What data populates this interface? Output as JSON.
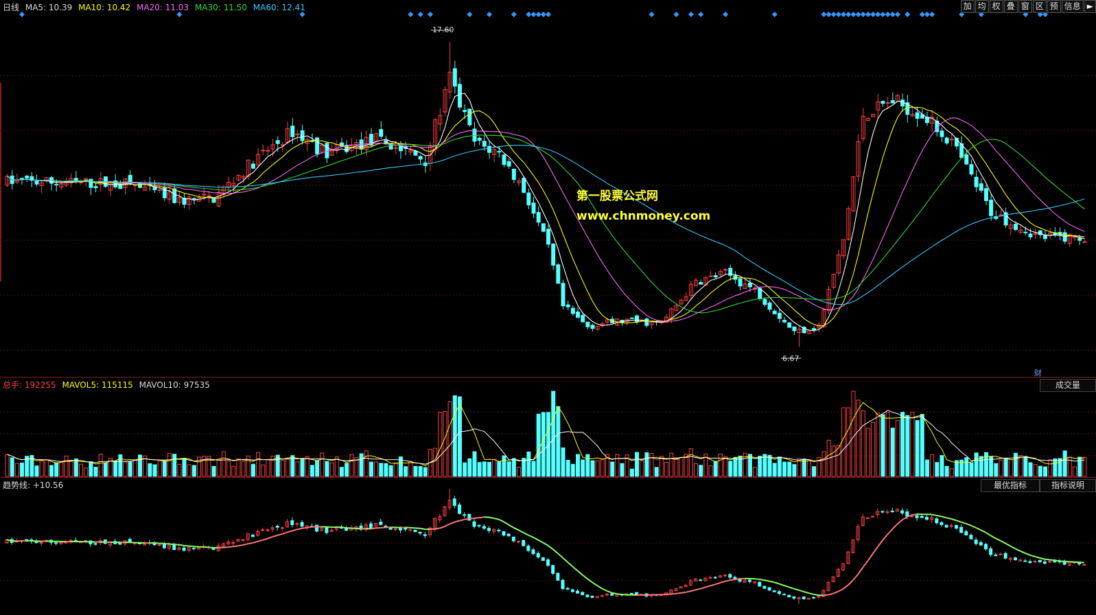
{
  "colors": {
    "up": "#ff4040",
    "down": "#54ffff",
    "ma5": "#ffffff",
    "ma10": "#ffff00",
    "ma20": "#ff66ff",
    "ma30": "#33dd33",
    "ma60": "#33ccff",
    "diamond": "#3399ff",
    "grid": "#5a1010"
  },
  "price_legend": {
    "period": "日线",
    "ma5_label": "MA5:",
    "ma5_value": "10.39",
    "ma10_label": "MA10:",
    "ma10_value": "10.42",
    "ma20_label": "MA20:",
    "ma20_value": "11.03",
    "ma30_label": "MA30:",
    "ma30_value": "11.50",
    "ma60_label": "MA60:",
    "ma60_value": "12.41"
  },
  "toolbar": {
    "buttons": [
      "加",
      "均",
      "权",
      "叠",
      "窗",
      "区",
      "预",
      "信息"
    ],
    "arrow_icon": "next-arrow-icon"
  },
  "price_markers": {
    "high_label": "17.60",
    "low_label": "6.67"
  },
  "watermark": {
    "line1": "第一股票公式网",
    "line2": "www.chnmoney.com"
  },
  "cai_label": "财",
  "volume_legend": {
    "total_label": "总手:",
    "total_value": "192255",
    "mavol5_label": "MAVOL5:",
    "mavol5_value": "115115",
    "mavol10_label": "MAVOL10:",
    "mavol10_value": "97535"
  },
  "volume_button": "成交量",
  "indicator_legend": {
    "label": "趋势线:",
    "value": "+10.56"
  },
  "indicator_buttons": {
    "best": "最优指标",
    "explain": "指标说明"
  }
}
